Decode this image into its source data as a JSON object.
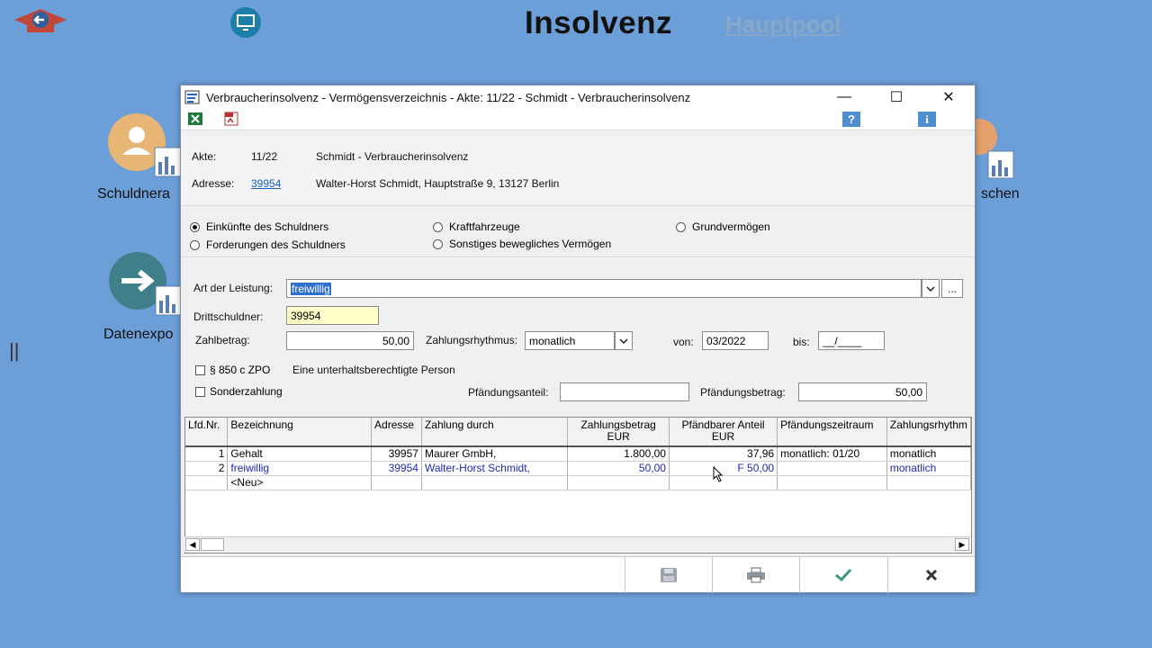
{
  "app": {
    "title": "Insolvenz",
    "pool_link": "Hauptpool"
  },
  "tiles": {
    "schuldner": "Schuldnera",
    "loeschen": "schen",
    "datenexport": "Datenexpo"
  },
  "window": {
    "title": "Verbraucherinsolvenz - Vermögensverzeichnis - Akte: 11/22 - Schmidt - Verbraucherinsolvenz",
    "minimize": "—",
    "maximize": "☐",
    "close": "✕"
  },
  "info": {
    "akte_label": "Akte:",
    "akte_value": "11/22",
    "akte_name": "Schmidt - Verbraucherinsolvenz",
    "adresse_label": "Adresse:",
    "adresse_id": "39954",
    "adresse_value": "Walter-Horst Schmidt, Hauptstraße 9, 13127 Berlin"
  },
  "radios": [
    {
      "label": "Einkünfte des Schuldners",
      "checked": true
    },
    {
      "label": "Forderungen des Schuldners",
      "checked": false
    },
    {
      "label": "Kraftfahrzeuge",
      "checked": false
    },
    {
      "label": "Sonstiges bewegliches Vermögen",
      "checked": false
    },
    {
      "label": "Grundvermögen",
      "checked": false
    }
  ],
  "form": {
    "art_label": "Art der Leistung:",
    "art_value": "freiwillig",
    "browse_label": "...",
    "dritt_label": "Drittschuldner:",
    "dritt_value": "39954",
    "zahlbetrag_label": "Zahlbetrag:",
    "zahlbetrag_value": "50,00",
    "rhythmus_label": "Zahlungsrhythmus:",
    "rhythmus_value": "monatlich",
    "von_label": "von:",
    "von_value": "03/2022",
    "bis_label": "bis:",
    "bis_value": "__/____",
    "p850_label": "§ 850 c ZPO",
    "p850_text": "Eine unterhaltsberechtigte Person",
    "sonder_label": "Sonderzahlung",
    "anteil_label": "Pfändungsanteil:",
    "anteil_value": "",
    "betrag_label": "Pfändungsbetrag:",
    "betrag_value": "50,00"
  },
  "grid": {
    "headers": [
      "Lfd.Nr.",
      "Bezeichnung",
      "Adresse",
      "Zahlung durch",
      "Zahlungsbetrag\nEUR",
      "Pfändbarer Anteil\nEUR",
      "Pfändungszeitraum",
      "Zahlungsrhythm"
    ],
    "rows": [
      [
        "1",
        "Gehalt",
        "39957",
        "Maurer GmbH,",
        "1.800,00",
        "37,96",
        "monatlich: 01/20",
        "monatlich"
      ],
      [
        "2",
        "freiwillig",
        "39954",
        "Walter-Horst Schmidt,",
        "50,00",
        "F 50,00",
        "",
        "monatlich"
      ],
      [
        "",
        "<Neu>",
        "",
        "",
        "",
        "",
        "",
        ""
      ]
    ]
  },
  "colors": {
    "background": "#6c9fd8",
    "accent": "#2f6fd0",
    "highlight_row": "#1c2bb0"
  }
}
